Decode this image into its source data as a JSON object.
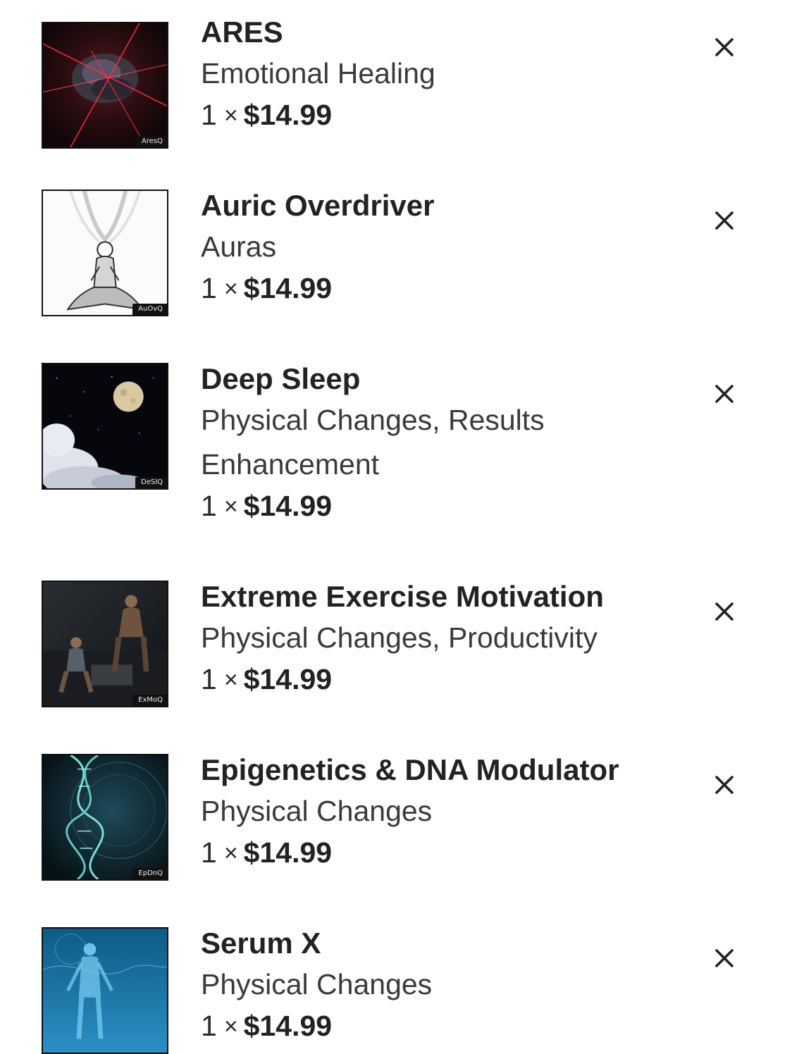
{
  "cart": {
    "items": [
      {
        "title": "ARES",
        "categories": "Emotional Healing",
        "quantity": "1",
        "times": "×",
        "price": "$14.99",
        "thumb_tag": "AresQ",
        "thumb_icon": "red-storm-artwork"
      },
      {
        "title": "Auric Overdriver",
        "categories": "Auras",
        "quantity": "1",
        "times": "×",
        "price": "$14.99",
        "thumb_tag": "AuOvQ",
        "thumb_icon": "meditating-figure-artwork"
      },
      {
        "title": "Deep Sleep",
        "categories": "Physical Changes, Results Enhancement",
        "quantity": "1",
        "times": "×",
        "price": "$14.99",
        "thumb_tag": "DeSlQ",
        "thumb_icon": "moon-clouds-artwork"
      },
      {
        "title": "Extreme Exercise Motivation",
        "categories": "Physical Changes, Productivity",
        "quantity": "1",
        "times": "×",
        "price": "$14.99",
        "thumb_tag": "ExMoQ",
        "thumb_icon": "gym-athletes-artwork"
      },
      {
        "title": "Epigenetics & DNA Modulator",
        "categories": "Physical Changes",
        "quantity": "1",
        "times": "×",
        "price": "$14.99",
        "thumb_tag": "EpDnQ",
        "thumb_icon": "dna-helix-artwork"
      },
      {
        "title": "Serum X",
        "categories": "Physical Changes",
        "quantity": "1",
        "times": "×",
        "price": "$14.99",
        "thumb_tag": "",
        "thumb_icon": "blue-human-artwork"
      }
    ],
    "remove_icon": "close-icon"
  }
}
